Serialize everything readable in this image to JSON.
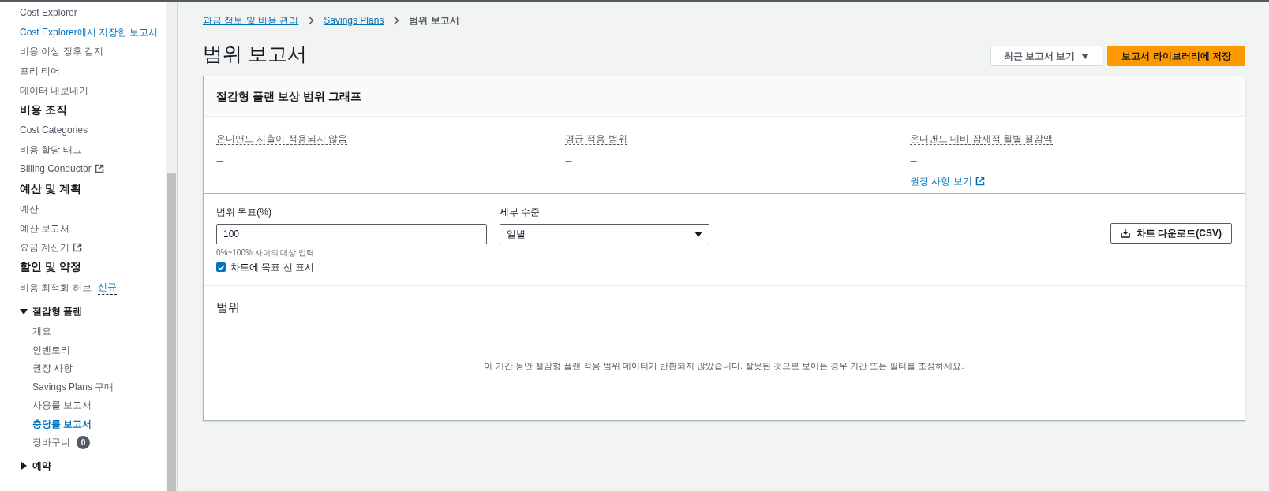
{
  "sidebar": {
    "items": [
      {
        "kind": "link",
        "label": "Cost Explorer",
        "selected": false
      },
      {
        "kind": "link",
        "label": "Cost Explorer에서 저장한 보고서",
        "selected": true
      },
      {
        "kind": "link",
        "label": "비용 이상 징후 감지",
        "selected": false
      },
      {
        "kind": "link",
        "label": "프리 티어",
        "selected": false
      },
      {
        "kind": "link",
        "label": "데이터 내보내기",
        "selected": false
      },
      {
        "kind": "heading",
        "label": "비용 조직"
      },
      {
        "kind": "link",
        "label": "Cost Categories",
        "selected": false
      },
      {
        "kind": "link",
        "label": "비용 할당 태그",
        "selected": false
      },
      {
        "kind": "link",
        "label": "Billing Conductor",
        "selected": false,
        "external": true
      },
      {
        "kind": "heading",
        "label": "예산 및 계획"
      },
      {
        "kind": "link",
        "label": "예산",
        "selected": false
      },
      {
        "kind": "link",
        "label": "예산 보고서",
        "selected": false
      },
      {
        "kind": "link",
        "label": "요금 계산기",
        "selected": false,
        "external": true
      },
      {
        "kind": "heading",
        "label": "할인 및 약정"
      },
      {
        "kind": "link",
        "label": "비용 최적화 허브",
        "selected": false,
        "tag": "신규"
      },
      {
        "kind": "group",
        "label": "절감형 플랜",
        "expanded": true,
        "children": [
          {
            "label": "개요",
            "selected": false
          },
          {
            "label": "인벤토리",
            "selected": false
          },
          {
            "label": "권장 사항",
            "selected": false
          },
          {
            "label": "Savings Plans 구매",
            "selected": false
          },
          {
            "label": "사용률 보고서",
            "selected": false
          },
          {
            "label": "충당률 보고서",
            "selected": true
          },
          {
            "label": "장바구니",
            "selected": false,
            "badge": "0"
          }
        ]
      },
      {
        "kind": "group",
        "label": "예약",
        "expanded": false
      }
    ]
  },
  "breadcrumbs": [
    {
      "label": "과금 정보 및 비용 관리",
      "link": true
    },
    {
      "label": "Savings Plans",
      "link": true
    },
    {
      "label": "범위 보고서",
      "link": false
    }
  ],
  "page_title": "범위 보고서",
  "header_buttons": [
    {
      "kind": "dropdown",
      "label": "최근 보고서 보기"
    },
    {
      "kind": "primary",
      "label": "보고서 라이브러리에 저장"
    }
  ],
  "card": {
    "title": "절감형 플랜 보상 범위 그래프",
    "metrics": [
      {
        "label": "온디맨드 지출이 적용되지 않음",
        "value": "–"
      },
      {
        "label": "평균 적용 범위",
        "value": "–"
      },
      {
        "label": "온디맨드 대비 잠재적 월별 절감액",
        "value": "–",
        "link": "권장 사항 보기"
      }
    ],
    "target_field": {
      "label": "범위 목표(%)",
      "value": "100",
      "hint": "0%~100% 사이의 대상 입력"
    },
    "granularity": {
      "label": "세부 수준",
      "value": "일별"
    },
    "show_target_line": {
      "label": "차트에 목표 선 표시",
      "checked": true
    },
    "download_button": "차트 다운로드(CSV)",
    "chart_title": "범위",
    "empty_message": "이 기간 동안 절감형 플랜 적용 범위 데이터가 반환되지 않았습니다. 잘못된 것으로 보이는 경우 기간 또는 필터를 조정하세요."
  }
}
